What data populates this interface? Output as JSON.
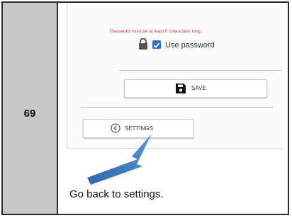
{
  "step": {
    "number": "69",
    "caption": "Go back to settings."
  },
  "screenshot": {
    "password_hint": "Password must be at least 6 characters long.",
    "use_password_label": "Use password",
    "use_password_checked": true,
    "save_label": "SAVE",
    "settings_label": "SETTINGS"
  },
  "icons": {
    "lock": "lock-icon",
    "checkbox": "checkbox-checked-icon",
    "save": "floppy-disk-icon",
    "back": "chevron-left-circle-icon",
    "arrow": "pointer-arrow-icon"
  },
  "colors": {
    "number_cell": "#c8c8c8",
    "error_text": "#e03a3a",
    "checkbox": "#2a6fd8",
    "arrow": "#3c78c0"
  }
}
